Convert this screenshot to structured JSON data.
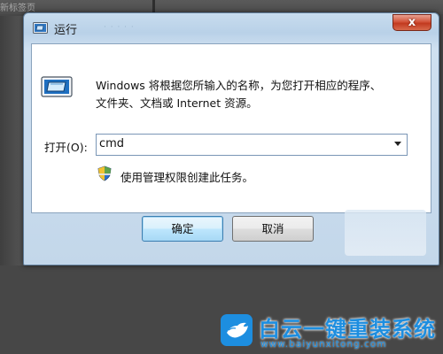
{
  "background": {
    "top_text": "新标签页",
    "strip_text": "· · · · ·"
  },
  "window": {
    "title": "运行",
    "close_label": "x",
    "description_line1": "Windows 将根据您所输入的名称，为您打开相应的程序、",
    "description_line2": "文件夹、文档或 Internet 资源。",
    "open_label": "打开(O):",
    "open_value": "cmd",
    "admin_note": "使用管理权限创建此任务。",
    "ok_label": "确定",
    "cancel_label": "取消"
  },
  "watermark": {
    "title": "白云一键重装系统",
    "url": "www.baiyunxitong.com"
  },
  "colors": {
    "accent": "#1d8ee0",
    "close_button": "#c23a1f"
  },
  "icons": [
    "run-icon",
    "shield-icon",
    "close-icon",
    "chevron-down-icon",
    "bird-logo-icon"
  ]
}
